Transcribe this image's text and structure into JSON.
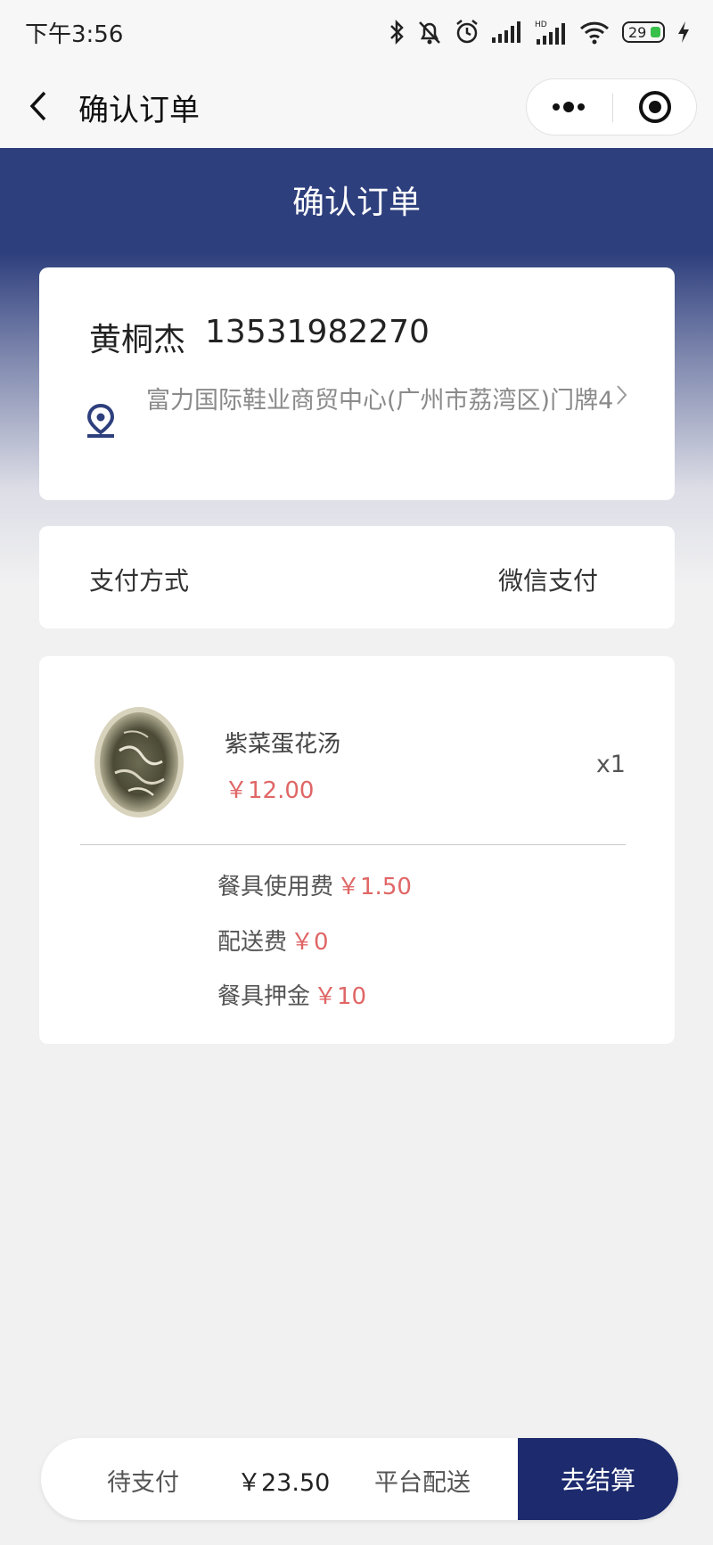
{
  "status_bar": {
    "time": "下午3:56",
    "battery": "29",
    "icons": [
      "bluetooth-icon",
      "mute-bell-icon",
      "alarm-icon",
      "signal-icon",
      "hd-signal-icon",
      "wifi-icon",
      "battery-icon",
      "charging-icon"
    ]
  },
  "nav": {
    "title": "确认订单"
  },
  "header": {
    "title": "确认订单"
  },
  "address": {
    "name": "黄桐杰",
    "phone": "13531982270",
    "address": "富力国际鞋业商贸中心(广州市荔湾区)门牌4"
  },
  "payment": {
    "label": "支付方式",
    "value": "微信支付"
  },
  "items": [
    {
      "name": "紫菜蛋花汤",
      "price": "￥12.00",
      "qty": "x1"
    }
  ],
  "fees": {
    "tableware_label": "餐具使用费",
    "tableware_amount": "￥1.50",
    "delivery_label": "配送费",
    "delivery_amount": "￥0",
    "deposit_label": "餐具押金",
    "deposit_amount": "￥10"
  },
  "bottom_bar": {
    "status": "待支付",
    "total": "￥23.50",
    "delivery": "平台配送",
    "checkout": "去结算"
  },
  "colors": {
    "header_blue": "#2e3f7d",
    "checkout_blue": "#1d2b6e",
    "price_red": "#e06666",
    "page_bg": "#f1f1f2"
  }
}
